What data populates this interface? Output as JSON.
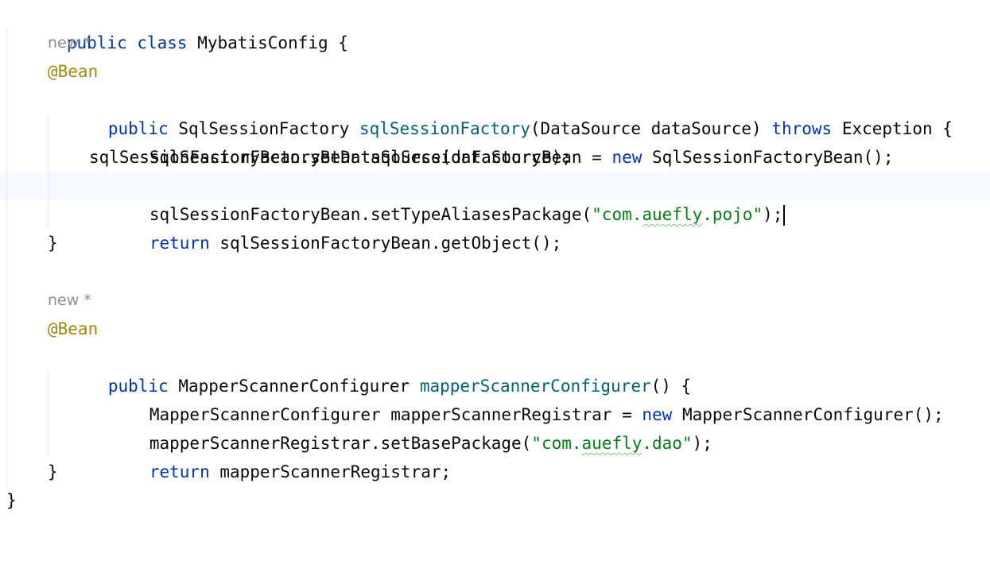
{
  "code": {
    "l1": {
      "kw": "public class ",
      "name": "MybatisConfig {"
    },
    "l2": {
      "hint": "new *"
    },
    "l3": {
      "ann": "@Bean"
    },
    "l4": {
      "kw1": "public ",
      "type": "SqlSessionFactory ",
      "method": "sqlSessionFactory",
      "params": "(DataSource dataSource) ",
      "kw2": "throws",
      "rest": " Exception {"
    },
    "l5": {
      "pre": "SqlSessionFactoryBean sqlSessionFactoryBean = ",
      "kw": "new",
      "post": " SqlSessionFactoryBean();"
    },
    "l6": {
      "text": "sqlSessionFactoryBean.setDataSource(dataSource);"
    },
    "l7": {
      "pre": "sqlSessionFactoryBean.setTypeAliasesPackage(",
      "str_open": "\"com.",
      "str_typo": "auefly",
      "str_close": ".pojo\"",
      "post": ");"
    },
    "l8": {
      "kw": "return",
      "post": " sqlSessionFactoryBean.getObject();"
    },
    "l9": {
      "text": "}"
    },
    "l11": {
      "hint": "new *"
    },
    "l12": {
      "ann": "@Bean"
    },
    "l13": {
      "kw": "public ",
      "type": "MapperScannerConfigurer ",
      "method": "mapperScannerConfigurer",
      "post": "() {"
    },
    "l14": {
      "pre": "MapperScannerConfigurer mapperScannerRegistrar = ",
      "kw": "new",
      "post": " MapperScannerConfigurer();"
    },
    "l15": {
      "pre": "mapperScannerRegistrar.setBasePackage(",
      "str_open": "\"com.",
      "str_typo": "auefly",
      "str_close": ".dao\"",
      "post": ");"
    },
    "l16": {
      "kw": "return",
      "post": " mapperScannerRegistrar;"
    },
    "l17": {
      "text": "}"
    },
    "l18": {
      "text": "}"
    }
  },
  "colors": {
    "keyword": "#0033b3",
    "method_declaration": "#00627a",
    "string": "#067d17",
    "annotation": "#9e880d",
    "hint": "#8c8c8c",
    "current_line": "#f5f8fe"
  }
}
